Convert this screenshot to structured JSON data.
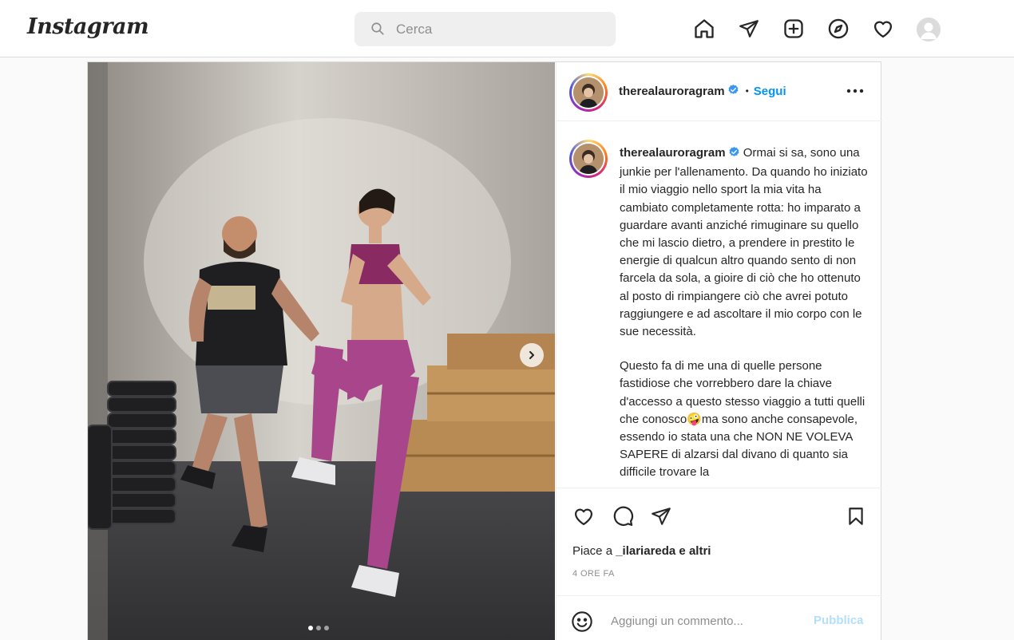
{
  "app": {
    "logo_text": "Instagram"
  },
  "search": {
    "placeholder": "Cerca",
    "icon": "search-icon"
  },
  "nav": {
    "icons": [
      "home-icon",
      "direct-message-icon",
      "new-post-icon",
      "explore-icon",
      "activity-heart-icon",
      "profile-avatar"
    ]
  },
  "post": {
    "carousel": {
      "slide_count": 3,
      "active_index": 0,
      "next_icon": "chevron-right-icon"
    },
    "header": {
      "username": "therealauroragram",
      "separator": "•",
      "follow_label": "Segui",
      "more_icon": "more-options-icon"
    },
    "caption": {
      "username": "therealauroragram",
      "paragraph1": "Ormai si sa, sono una junkie per l'allenamento. Da quando ho iniziato il mio viaggio nello sport la mia vita ha cambiato completamente rotta: ho imparato a guardare avanti anziché rimuginare su quello che mi lascio dietro, a prendere in prestito le energie di qualcun altro quando sento di non farcela da sola, a gioire di ciò che ho ottenuto al posto di rimpiangere ciò che avrei potuto raggiungere e ad ascoltare il mio corpo con le sue necessità.",
      "paragraph2a": "Questo fa di me una di quelle persone fastidiose che vorrebbero dare la chiave d'accesso a questo stesso viaggio a tutti quelli che conosco",
      "paragraph2_emoji": "🤪",
      "paragraph2b": "ma sono anche consapevole, essendo io stata una che NON NE VOLEVA SAPERE di alzarsi dal divano di quanto sia difficile trovare la"
    },
    "actions": {
      "icons": [
        "like-heart-icon",
        "comment-icon",
        "share-icon",
        "save-bookmark-icon"
      ]
    },
    "likes": {
      "prefix": "Piace a ",
      "user": "_ilariareda",
      "suffix": " e altri"
    },
    "timestamp": "4 ORE FA",
    "add_comment": {
      "placeholder": "Aggiungi un commento...",
      "publish_label": "Pubblica",
      "emoji_icon": "emoji-icon"
    }
  },
  "colors": {
    "accent": "#0095f6",
    "verified": "#3897f0",
    "publish_disabled": "#b2dffc",
    "border": "#dbdbdb"
  }
}
